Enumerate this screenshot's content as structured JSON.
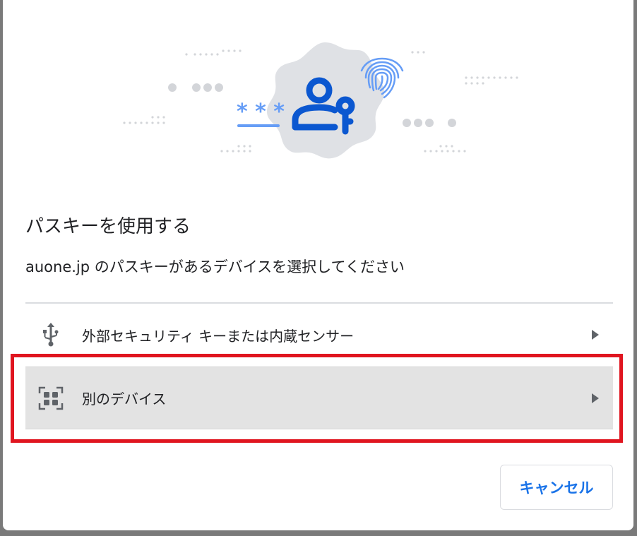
{
  "dialog": {
    "illustration_icon": "passkey-person-key-illustration",
    "title": "パスキーを使用する",
    "subtitle": "auone.jp のパスキーがあるデバイスを選択してください",
    "options": [
      {
        "icon": "usb-icon",
        "label": "外部セキュリティ キーまたは内蔵センサー"
      },
      {
        "icon": "qr-code-icon",
        "label": "別のデバイス"
      }
    ],
    "cancel_label": "キャンセル"
  },
  "colors": {
    "accent": "#1a73e8",
    "highlight": "#e0151f",
    "selected_row": "#e3e3e3"
  }
}
